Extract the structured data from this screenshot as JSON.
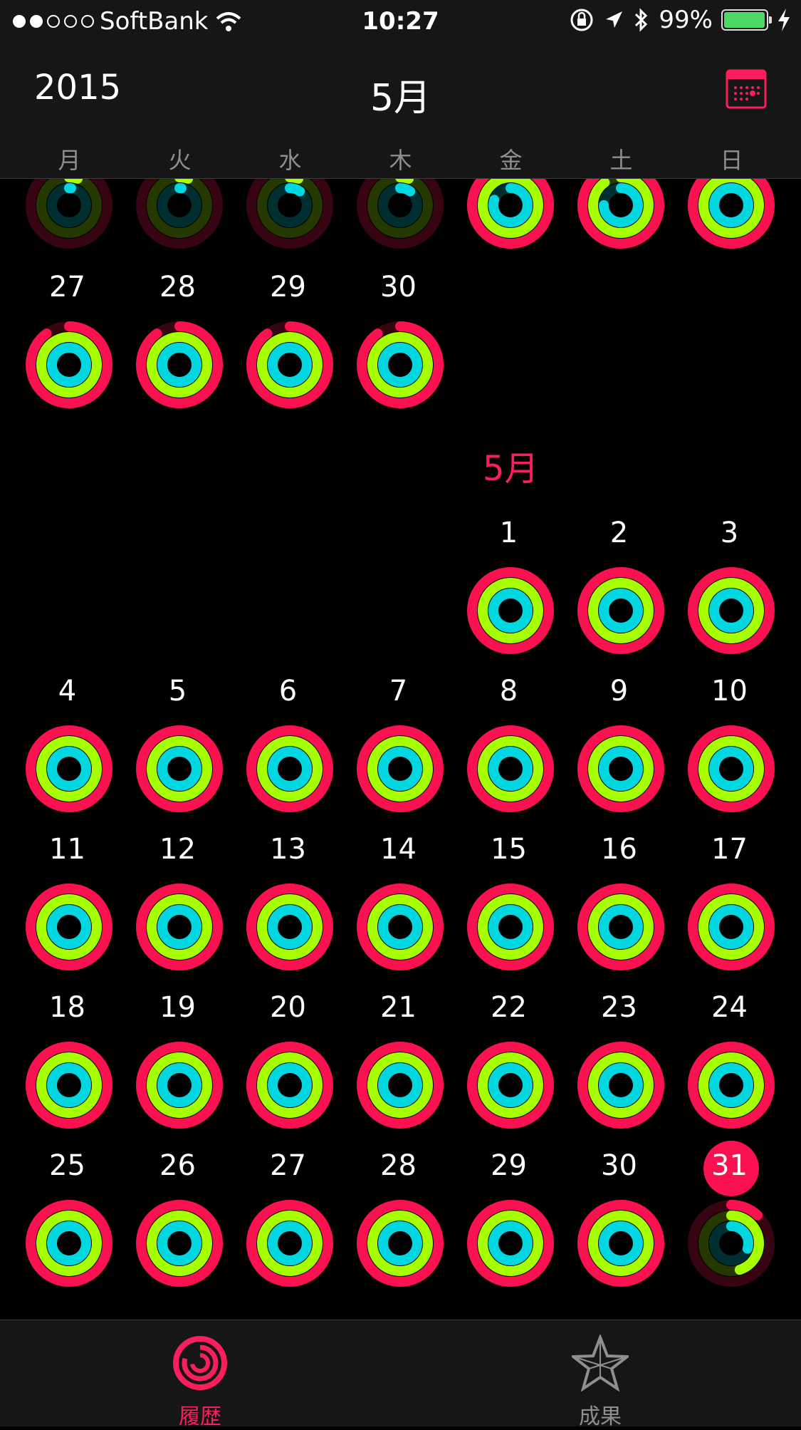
{
  "status_bar": {
    "carrier": "SoftBank",
    "time": "10:27",
    "battery_percent": "99%",
    "battery_level": 0.99,
    "signal_dots_filled": 2,
    "signal_dots_total": 5
  },
  "nav": {
    "year": "2015",
    "month": "5月"
  },
  "weekdays": [
    "月",
    "火",
    "水",
    "木",
    "金",
    "土",
    "日"
  ],
  "may_label": "5月",
  "april_tail": [
    "27",
    "28",
    "29",
    "30"
  ],
  "may_days": [
    "1",
    "2",
    "3",
    "4",
    "5",
    "6",
    "7",
    "8",
    "9",
    "10",
    "11",
    "12",
    "13",
    "14",
    "15",
    "16",
    "17",
    "18",
    "19",
    "20",
    "21",
    "22",
    "23",
    "24",
    "25",
    "26",
    "27",
    "28",
    "29",
    "30",
    "31"
  ],
  "today": "31",
  "tabs": [
    {
      "label": "履歴",
      "icon": "activity-rings-icon",
      "active": true
    },
    {
      "label": "成果",
      "icon": "star-icon",
      "active": false
    }
  ],
  "colors": {
    "move": "#fa114f",
    "exercise": "#a6ff00",
    "stand": "#00d7e0",
    "accent": "#fa1f5c",
    "tab_inactive": "#8e8e93"
  }
}
